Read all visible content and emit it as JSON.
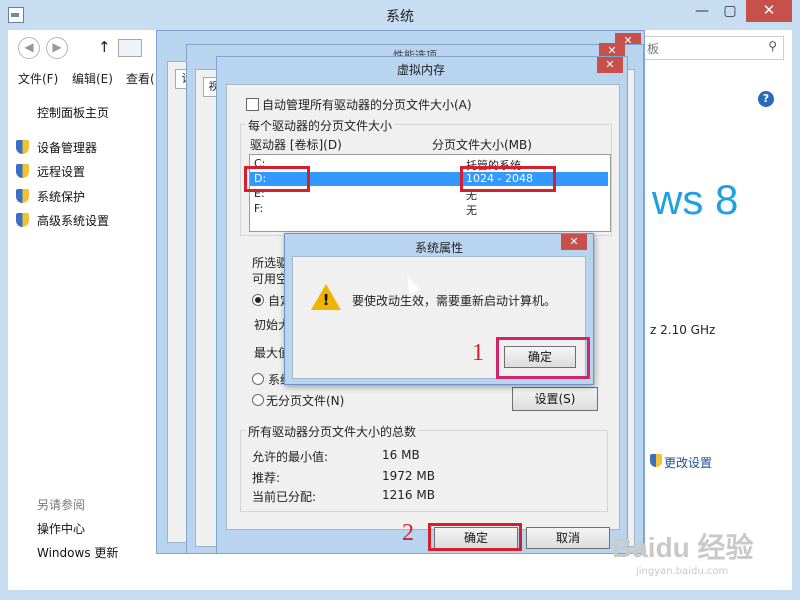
{
  "main_window": {
    "title": "系统",
    "minimize": "—",
    "maximize": "▢",
    "close": "✕",
    "nav_back": "◀",
    "nav_forward": "▶",
    "nav_up": "↑",
    "search_placeholder_fragment": "板",
    "menu": [
      "文件(F)",
      "编辑(E)",
      "查看("
    ],
    "left_nav": {
      "home": "控制面板主页",
      "items": [
        "设备管理器",
        "远程设置",
        "系统保护",
        "高级系统设置"
      ],
      "see_also_header": "另请参阅",
      "see_also": [
        "操作中心",
        "Windows 更新"
      ]
    },
    "right": {
      "windows_logo_text": "ws 8",
      "cpu_fragment": "z   2.10 GHz",
      "change_settings": "更改设置"
    }
  },
  "back_dialogs": {
    "title_fragment_1": "计",
    "title_fragment_2": "性能选项",
    "tab_fragment": "视"
  },
  "virtual_memory": {
    "title": "虚拟内存",
    "auto_manage_label": "自动管理所有驱动器的分页文件大小(A)",
    "auto_manage_checked": false,
    "per_drive_group": "每个驱动器的分页文件大小",
    "col_drive": "驱动器 [卷标](D)",
    "col_size": "分页文件大小(MB)",
    "drives": [
      {
        "drive": "C:",
        "size": "托管的系统"
      },
      {
        "drive": "D:",
        "size": "1024 - 2048"
      },
      {
        "drive": "E:",
        "size": "无"
      },
      {
        "drive": "F:",
        "size": "无"
      }
    ],
    "selected_drive_label": "所选驱",
    "available_label": "可用空",
    "custom_size_label": "自定",
    "initial_label": "初始大",
    "max_label": "最大值",
    "system_managed_label": "系统",
    "no_paging_label": "无分页文件(N)",
    "set_button": "设置(S)",
    "totals_group": "所有驱动器分页文件大小的总数",
    "min_allowed_label": "允许的最小值:",
    "min_allowed_value": "16 MB",
    "recommended_label": "推荐:",
    "recommended_value": "1972 MB",
    "allocated_label": "当前已分配:",
    "allocated_value": "1216 MB",
    "ok_button": "确定",
    "cancel_button": "取消",
    "close": "✕"
  },
  "system_properties_alert": {
    "title": "系统属性",
    "message": "要使改动生效，需要重新启动计算机。",
    "ok_button": "确定",
    "close": "✕"
  },
  "annotations": {
    "step1": "1",
    "step2": "2",
    "highlight_color": "#d71f2b"
  },
  "watermark": {
    "brand": "Baidu 经验",
    "url": "jingyan.baidu.com"
  }
}
